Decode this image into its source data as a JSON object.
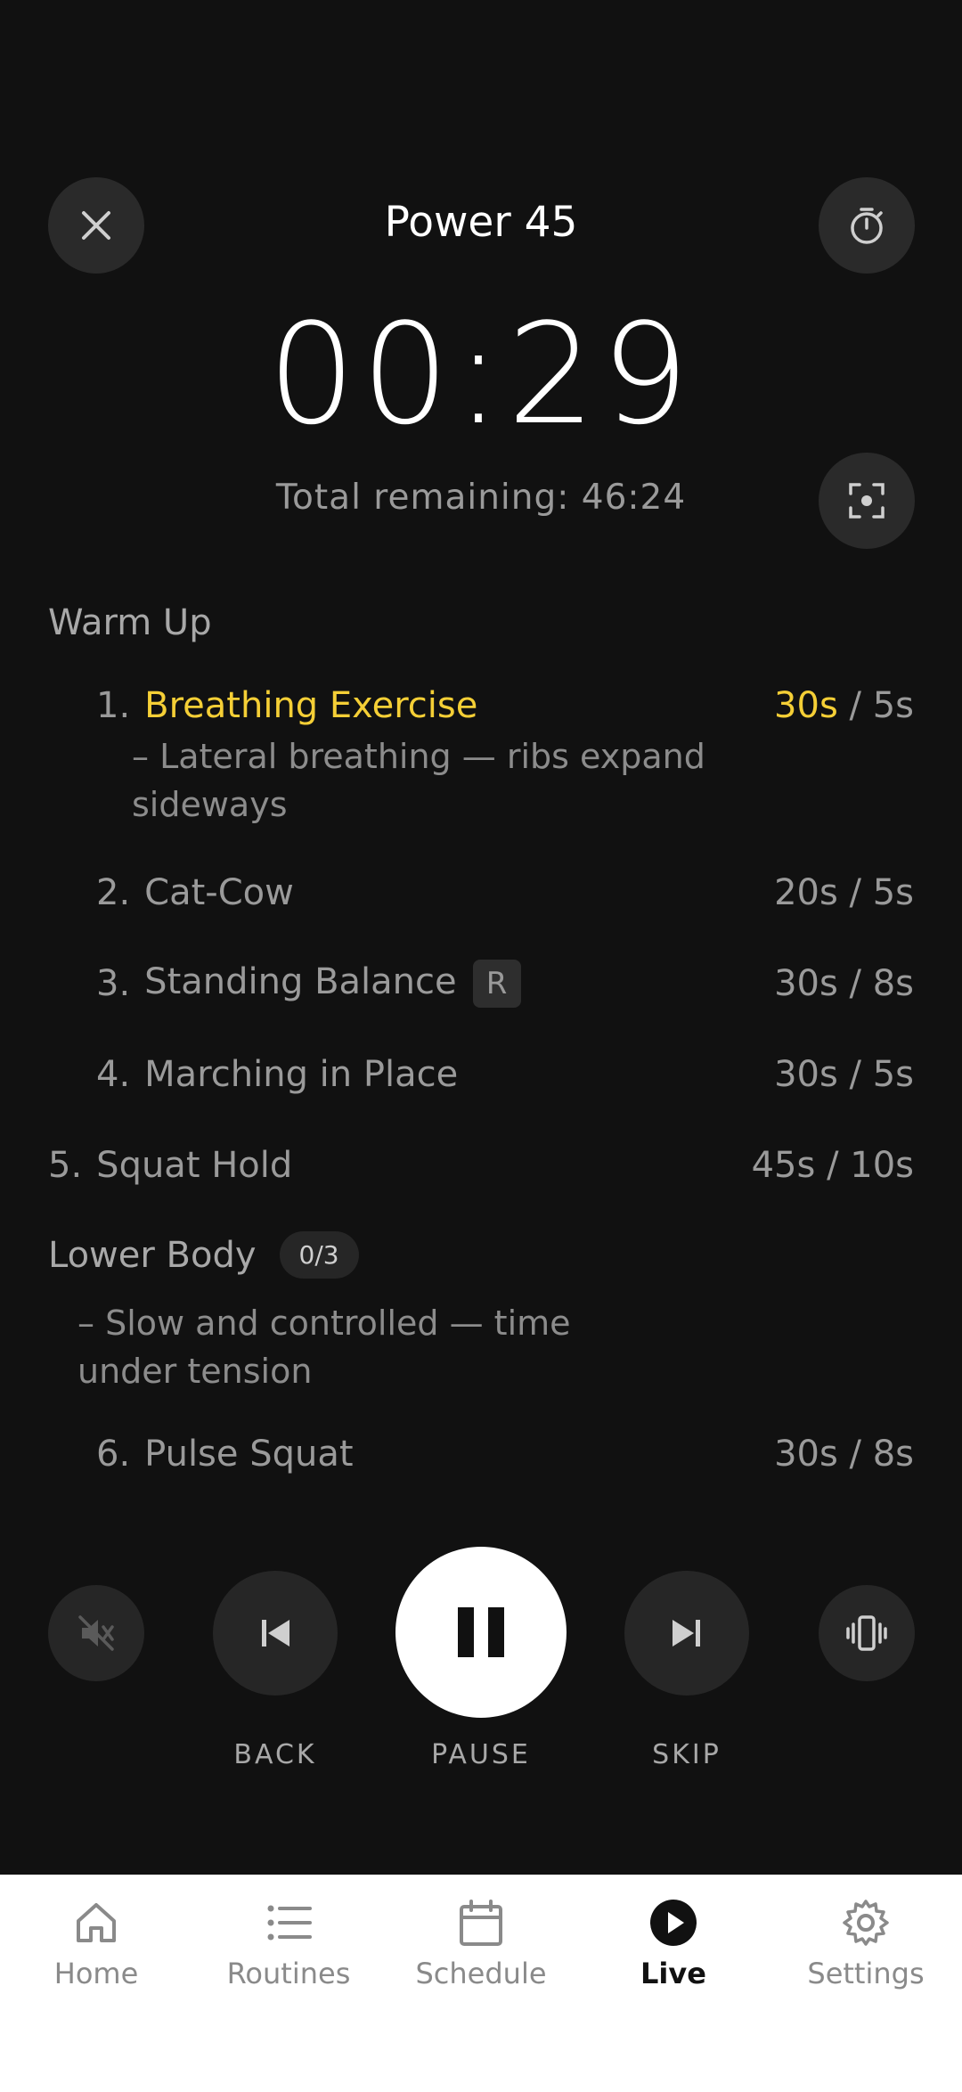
{
  "header": {
    "title": "Power 45",
    "timer": "00:29",
    "remaining": "Total remaining: 46:24"
  },
  "sections": [
    {
      "title": "Warm Up"
    },
    {
      "title": "Lower Body",
      "badge": "0/3",
      "note_line1": "– Slow and controlled — time",
      "note_line2": "under tension"
    }
  ],
  "exercises": [
    {
      "num": "1.",
      "name": "Breathing Exercise",
      "work": "30s",
      "rest": " / 5s",
      "note_line1": "– Lateral breathing — ribs expand",
      "note_line2": "sideways"
    },
    {
      "num": "2.",
      "name": "Cat-Cow",
      "duration": "20s / 5s"
    },
    {
      "num": "3.",
      "name": "Standing Balance",
      "badge": "R",
      "duration": "30s / 8s"
    },
    {
      "num": "4.",
      "name": "Marching in Place",
      "duration": "30s / 5s"
    },
    {
      "num": "5.",
      "name": "Squat Hold",
      "duration": "45s / 10s"
    },
    {
      "num": "6.",
      "name": "Pulse Squat",
      "duration": "30s / 8s"
    }
  ],
  "controls": {
    "back": "BACK",
    "pause": "PAUSE",
    "skip": "SKIP"
  },
  "tabs": [
    {
      "label": "Home",
      "icon": "home-icon"
    },
    {
      "label": "Routines",
      "icon": "list-icon"
    },
    {
      "label": "Schedule",
      "icon": "calendar-icon"
    },
    {
      "label": "Live",
      "icon": "play-icon",
      "active": true
    },
    {
      "label": "Settings",
      "icon": "gear-icon"
    }
  ],
  "colors": {
    "background": "#111111",
    "accent": "#f5cf36",
    "muted_text": "#9a9a9a"
  }
}
